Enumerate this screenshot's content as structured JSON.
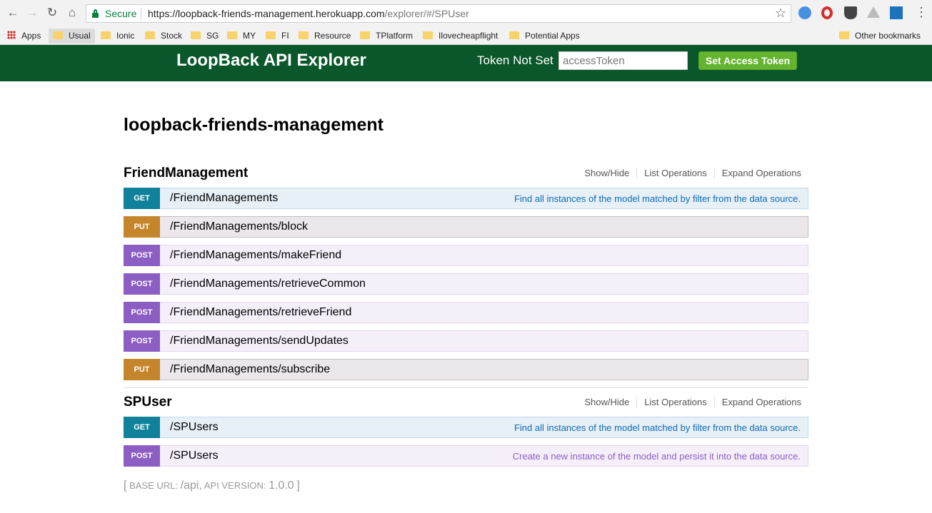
{
  "browser": {
    "secure_label": "Secure",
    "url_host": "https://loopback-friends-management.herokuapp.com",
    "url_path": "/explorer/#/SPUser",
    "bookmarks": {
      "apps": "Apps",
      "usual": "Usual",
      "ionic": "Ionic",
      "stock": "Stock",
      "sg": "SG",
      "my": "MY",
      "fi": "FI",
      "resource": "Resource",
      "tplatform": "TPlatform",
      "ilovecheapflight": "Ilovecheapflight",
      "potential_apps": "Potential Apps",
      "other": "Other bookmarks"
    }
  },
  "header": {
    "brand": "LoopBack API Explorer",
    "token_status": "Token Not Set",
    "token_placeholder": "accessToken",
    "set_token_button": "Set Access Token",
    "colors": {
      "header_bg": "#09572a",
      "button_bg": "#65b42f"
    }
  },
  "app_title": "loopback-friends-management",
  "resource_links": {
    "show_hide": "Show/Hide",
    "list_operations": "List Operations",
    "expand_operations": "Expand Operations"
  },
  "resources": [
    {
      "name": "FriendManagement",
      "operations": [
        {
          "method": "GET",
          "path": "/FriendManagements",
          "summary": "Find all instances of the model matched by filter from the data source."
        },
        {
          "method": "PUT",
          "path": "/FriendManagements/block",
          "summary": ""
        },
        {
          "method": "POST",
          "path": "/FriendManagements/makeFriend",
          "summary": ""
        },
        {
          "method": "POST",
          "path": "/FriendManagements/retrieveCommon",
          "summary": ""
        },
        {
          "method": "POST",
          "path": "/FriendManagements/retrieveFriend",
          "summary": ""
        },
        {
          "method": "POST",
          "path": "/FriendManagements/sendUpdates",
          "summary": ""
        },
        {
          "method": "PUT",
          "path": "/FriendManagements/subscribe",
          "summary": ""
        }
      ]
    },
    {
      "name": "SPUser",
      "operations": [
        {
          "method": "GET",
          "path": "/SPUsers",
          "summary": "Find all instances of the model matched by filter from the data source."
        },
        {
          "method": "POST",
          "path": "/SPUsers",
          "summary": "Create a new instance of the model and persist it into the data source."
        }
      ]
    }
  ],
  "footer": {
    "open_bracket": "[",
    "base_url_label": "BASE URL:",
    "base_url": "/api",
    "comma": ",",
    "api_version_label": "API VERSION:",
    "api_version": "1.0.0",
    "close_bracket": "]"
  }
}
